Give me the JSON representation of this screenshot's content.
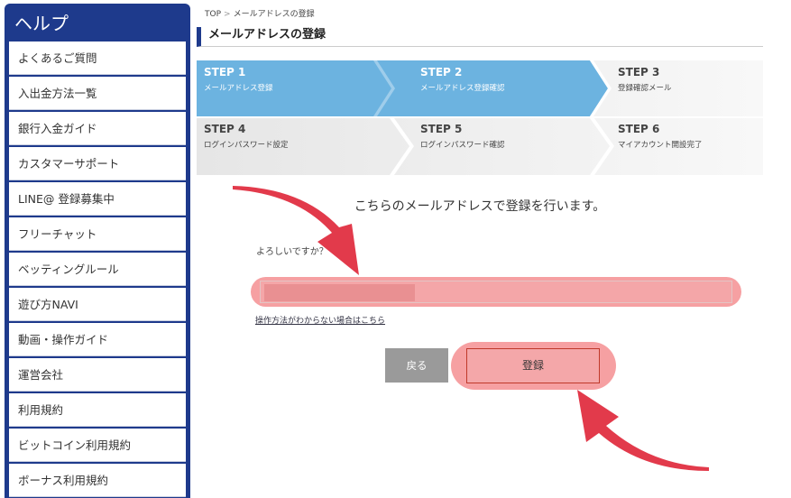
{
  "sidebar": {
    "title": "ヘルプ",
    "items": [
      {
        "label": "よくあるご質問"
      },
      {
        "label": "入出金方法一覧"
      },
      {
        "label": "銀行入金ガイド"
      },
      {
        "label": "カスタマーサポート"
      },
      {
        "label": "LINE@ 登録募集中"
      },
      {
        "label": "フリーチャット"
      },
      {
        "label": "ベッティングルール"
      },
      {
        "label": "遊び方NAVI"
      },
      {
        "label": "動画・操作ガイド"
      },
      {
        "label": "運営会社"
      },
      {
        "label": "利用規約"
      },
      {
        "label": "ビットコイン利用規約"
      },
      {
        "label": "ボーナス利用規約"
      }
    ]
  },
  "breadcrumb": {
    "home": "TOP",
    "separator": ">",
    "current": "メールアドレスの登録"
  },
  "page": {
    "title": "メールアドレスの登録"
  },
  "steps": [
    {
      "num": "STEP 1",
      "label": "メールアドレス登録",
      "state": "active"
    },
    {
      "num": "STEP 2",
      "label": "メールアドレス登録確認",
      "state": "active"
    },
    {
      "num": "STEP 3",
      "label": "登録確認メール",
      "state": "inactive"
    },
    {
      "num": "STEP 4",
      "label": "ログインパスワード設定",
      "state": "inactive"
    },
    {
      "num": "STEP 5",
      "label": "ログインパスワード確認",
      "state": "inactive"
    },
    {
      "num": "STEP 6",
      "label": "マイアカウント開設完了",
      "state": "inactive"
    }
  ],
  "main": {
    "message": "こちらのメールアドレスで登録を行います。",
    "confirm_text": "よろしいですか？",
    "help_link": "操作方法がわからない場合はこちら",
    "back_button": "戻る",
    "submit_button": "登録"
  },
  "colors": {
    "brand_navy": "#1e3a8c",
    "step_active": "#6cb3e0",
    "highlight_pink": "#f6a0a2",
    "arrow_red": "#e23a4b"
  }
}
